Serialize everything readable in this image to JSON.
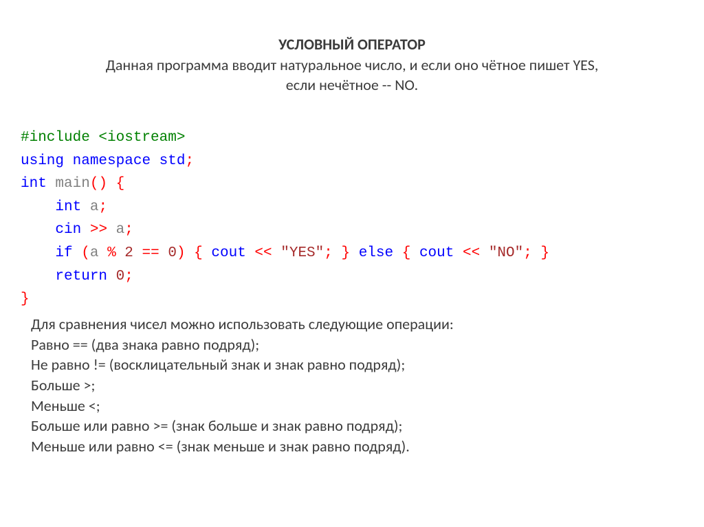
{
  "header": {
    "title": "УСЛОВНЫЙ ОПЕРАТОР",
    "line1": "Данная программа вводит натуральное число, и если оно чётное пишет YES,",
    "line2": "если нечётное -- NO."
  },
  "code": {
    "t_include": "#include <iostream>",
    "t_using": "using",
    "t_namespace": "namespace",
    "t_std": "std",
    "t_semi": ";",
    "t_int": "int",
    "t_main": "main",
    "t_parens": "()",
    "t_sp": " ",
    "t_obrace": "{",
    "t_cbrace": "}",
    "t_a": "a",
    "t_cin": "cin",
    "t_shr": ">>",
    "t_if": "if",
    "t_oparen": "(",
    "t_cparen": ")",
    "t_mod": "%",
    "t_2": "2",
    "t_eqeq": "==",
    "t_0": "0",
    "t_cout": "cout",
    "t_shl": "<<",
    "t_yes": "\"YES\"",
    "t_no": "\"NO\"",
    "t_else": "else",
    "t_return": "return"
  },
  "footer": {
    "l0": "Для сравнения чисел можно использовать следующие операции:",
    "l1": "Равно == (два знака равно подряд);",
    "l2": "Не равно != (восклицательный знак и знак равно подряд);",
    "l3": "Больше >;",
    "l4": "Меньше <;",
    "l5": "Больше или равно >= (знак больше и знак равно подряд);",
    "l6": "Меньше или равно <= (знак меньше и знак равно подряд)."
  }
}
